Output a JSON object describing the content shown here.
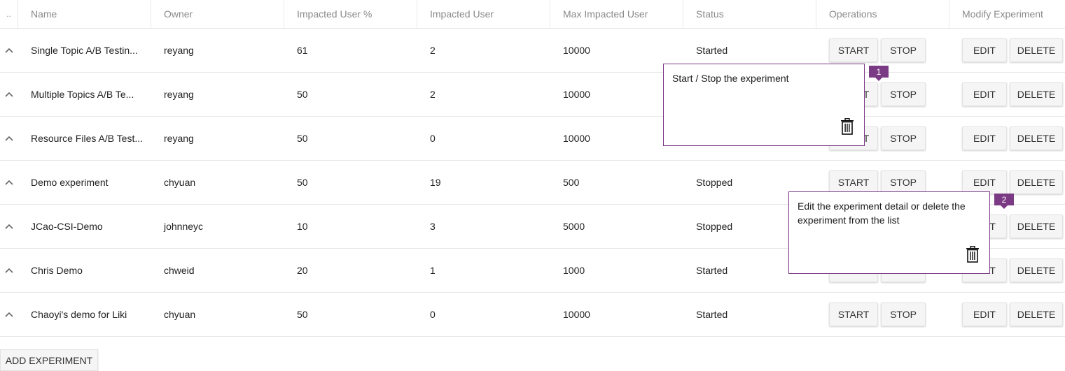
{
  "header": {
    "col0": "..",
    "name": "Name",
    "owner": "Owner",
    "impacted_pct": "Impacted User %",
    "impacted_user": "Impacted User",
    "max_impacted": "Max Impacted User",
    "status": "Status",
    "operations": "Operations",
    "modify": "Modify Experiment"
  },
  "buttons": {
    "start": "START",
    "stop": "STOP",
    "edit": "EDIT",
    "delete": "DELETE",
    "add": "ADD EXPERIMENT"
  },
  "rows": [
    {
      "name": "Single Topic A/B Testin...",
      "owner": "reyang",
      "impacted_pct": "61",
      "impacted_user": "2",
      "max_impacted": "10000",
      "status": "Started"
    },
    {
      "name": "Multiple Topics A/B Te...",
      "owner": "reyang",
      "impacted_pct": "50",
      "impacted_user": "2",
      "max_impacted": "10000",
      "status": ""
    },
    {
      "name": "Resource Files A/B Test...",
      "owner": "reyang",
      "impacted_pct": "50",
      "impacted_user": "0",
      "max_impacted": "10000",
      "status": ""
    },
    {
      "name": "Demo experiment",
      "owner": "chyuan",
      "impacted_pct": "50",
      "impacted_user": "19",
      "max_impacted": "500",
      "status": "Stopped"
    },
    {
      "name": "JCao-CSI-Demo",
      "owner": "johnneyc",
      "impacted_pct": "10",
      "impacted_user": "3",
      "max_impacted": "5000",
      "status": "Stopped"
    },
    {
      "name": "Chris Demo",
      "owner": "chweid",
      "impacted_pct": "20",
      "impacted_user": "1",
      "max_impacted": "1000",
      "status": "Started"
    },
    {
      "name": "Chaoyi's demo for Liki",
      "owner": "chyuan",
      "impacted_pct": "50",
      "impacted_user": "0",
      "max_impacted": "10000",
      "status": "Started"
    }
  ],
  "tips": [
    {
      "number": "1",
      "text": "Start / Stop the experiment"
    },
    {
      "number": "2",
      "text": "Edit the experiment detail or delete the experiment from the list"
    }
  ],
  "colors": {
    "accent": "#7b3a84"
  }
}
